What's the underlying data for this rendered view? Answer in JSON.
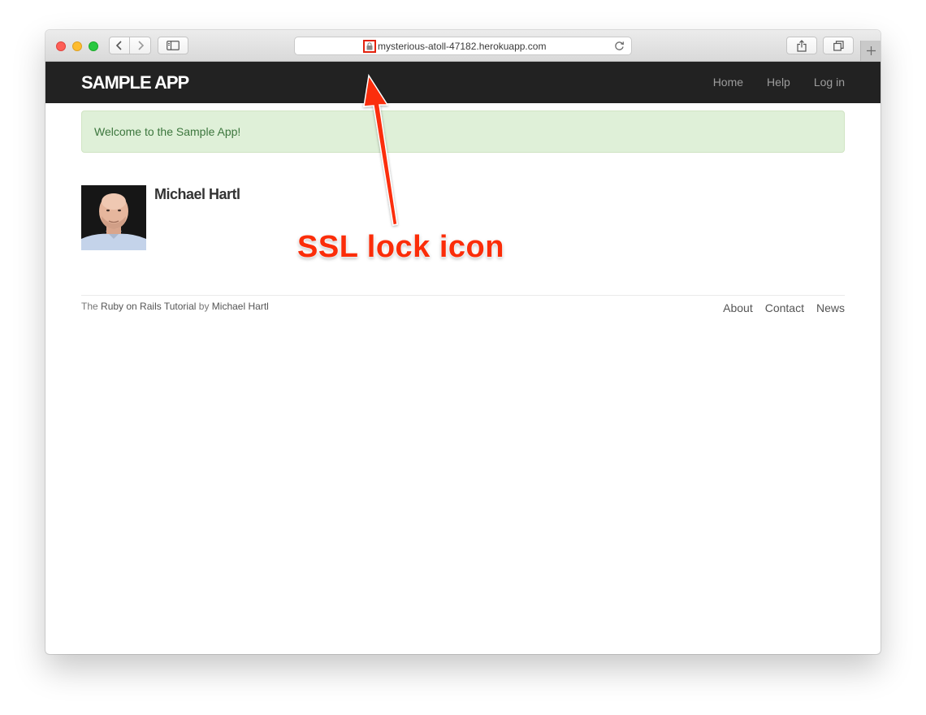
{
  "browser": {
    "url": "mysterious-atoll-47182.herokuapp.com",
    "icons": {
      "back": "chevron-left-icon",
      "forward": "chevron-right-icon",
      "sidebar": "sidebar-icon",
      "lock": "lock-icon",
      "reload": "reload-icon",
      "share": "share-icon",
      "tabs": "tab-overview-icon",
      "new_tab": "plus-icon"
    }
  },
  "header": {
    "logo": "sample app",
    "nav": [
      {
        "label": "Home"
      },
      {
        "label": "Help"
      },
      {
        "label": "Log in"
      }
    ]
  },
  "flash": {
    "message": "Welcome to the Sample App!"
  },
  "profile": {
    "name": "Michael Hartl"
  },
  "footer": {
    "credit_prefix": "The",
    "credit_link": "Ruby on Rails Tutorial",
    "credit_by": "by",
    "credit_author": "Michael Hartl",
    "links": [
      {
        "label": "About"
      },
      {
        "label": "Contact"
      },
      {
        "label": "News"
      }
    ]
  },
  "annotation": {
    "text": "SSL lock icon"
  },
  "colors": {
    "navbar": "#222222",
    "flash_bg": "#dff0d8",
    "flash_text": "#3c763d",
    "annotation": "#fb2d09"
  }
}
